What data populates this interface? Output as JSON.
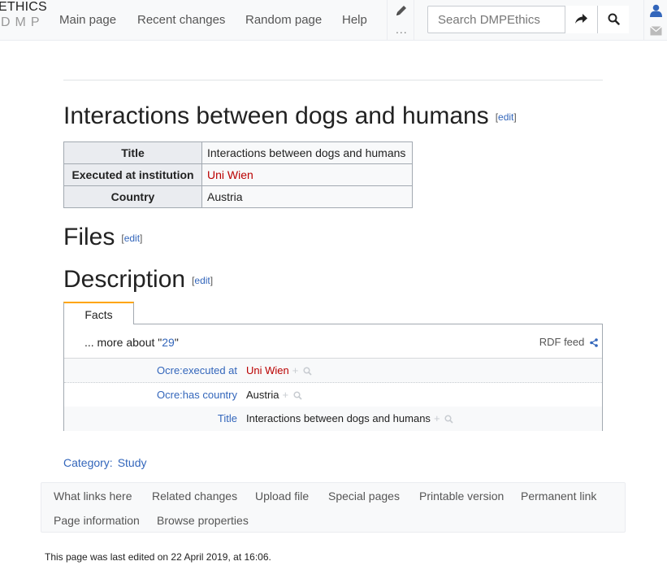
{
  "logo": {
    "line1": "ETHICS",
    "line2": "DMP"
  },
  "nav": {
    "main_page": "Main page",
    "recent_changes": "Recent changes",
    "random_page": "Random page",
    "help": "Help",
    "more": "..."
  },
  "search": {
    "placeholder": "Search DMPEthics"
  },
  "icons": {
    "pencil": "pencil-icon",
    "go": "share-arrow-icon",
    "search": "magnifier-icon",
    "user": "user-icon",
    "mail": "envelope-icon",
    "rdf": "share-icon"
  },
  "page": {
    "title": "Interactions between dogs and humans",
    "edit_label": "edit"
  },
  "infobox": {
    "rows": [
      {
        "label": "Title",
        "value": "Interactions between dogs and humans"
      },
      {
        "label": "Executed at institution",
        "value": "Uni Wien"
      },
      {
        "label": "Country",
        "value": "Austria"
      }
    ]
  },
  "sections": {
    "files": "Files",
    "description": "Description"
  },
  "facts": {
    "tab": "Facts",
    "more_prefix": "... more about \"",
    "more_subject": "29",
    "more_suffix": "\"",
    "rdf_feed": "RDF feed",
    "plus": "+",
    "rows": [
      {
        "property": "Ocre:executed at",
        "value": "Uni Wien"
      },
      {
        "property": "Ocre:has country",
        "value": "Austria"
      },
      {
        "property": "Title",
        "value": "Interactions between dogs and humans"
      }
    ]
  },
  "category": {
    "label": "Category:",
    "value": "Study"
  },
  "tools": {
    "what_links_here": "What links here",
    "related_changes": "Related changes",
    "upload_file": "Upload file",
    "special_pages": "Special pages",
    "printable_version": "Printable version",
    "permanent_link": "Permanent link",
    "page_information": "Page information",
    "browse_properties": "Browse properties"
  },
  "last_modified": "This page was last edited on 22 April 2019, at 16:06.",
  "colors": {
    "link": "#3366bb",
    "redlink": "#ba0000",
    "tab_accent": "#ffa500"
  }
}
